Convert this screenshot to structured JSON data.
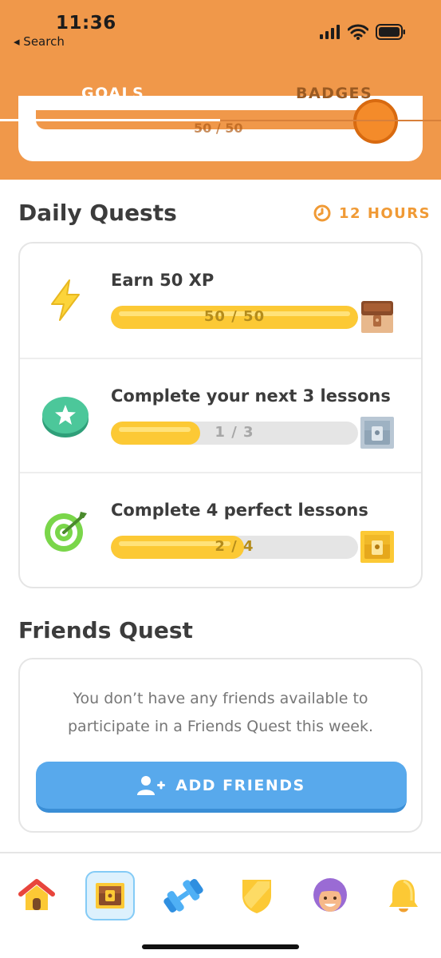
{
  "status_bar": {
    "time": "11:36",
    "back_label": "◂ Search"
  },
  "tabs": [
    {
      "label": "GOALS",
      "active": true
    },
    {
      "label": "BADGES",
      "active": false
    }
  ],
  "previous_card": {
    "progress_text": "50 / 50"
  },
  "daily_quests": {
    "title": "Daily Quests",
    "timer": "12 HOURS",
    "quests": [
      {
        "title": "Earn 50 XP",
        "current": 50,
        "total": 50,
        "progress_text": "50 / 50",
        "icon": "lightning-icon",
        "reward": "opened-chest-icon"
      },
      {
        "title": "Complete your next 3 lessons",
        "current": 1,
        "total": 3,
        "progress_text": "1 / 3",
        "icon": "star-badge-icon",
        "reward": "silver-chest-icon"
      },
      {
        "title": "Complete 4 perfect lessons",
        "current": 2,
        "total": 4,
        "progress_text": "2 / 4",
        "icon": "target-icon",
        "reward": "gold-chest-icon"
      }
    ]
  },
  "friends_quest": {
    "title": "Friends Quest",
    "message": "You don’t have any friends available to participate in a Friends Quest this week.",
    "button_label": "ADD FRIENDS"
  },
  "nav": {
    "items": [
      "home-icon",
      "quests-chest-icon",
      "practice-dumbbell-icon",
      "leagues-shield-icon",
      "profile-avatar-icon",
      "notifications-bell-icon"
    ],
    "active": "quests-chest-icon"
  },
  "colors": {
    "header": "#f0984a",
    "progress": "#fcc935",
    "button": "#58a9ec",
    "timer": "#f09a35"
  }
}
